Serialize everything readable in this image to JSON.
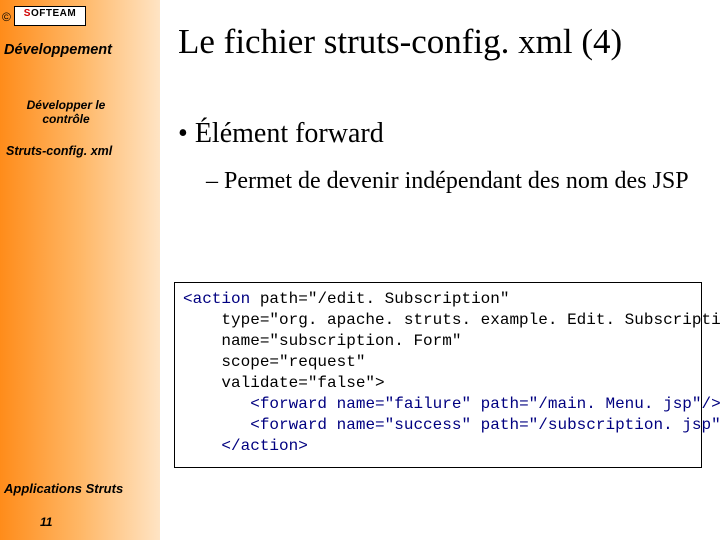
{
  "copyright_mark": "©",
  "logo": {
    "left": "S",
    "rest": "OFTEAM"
  },
  "sidebar": {
    "heading": "Développement",
    "sub1_l1": "Développer le",
    "sub1_l2": "contrôle",
    "sub2": "Struts-config. xml",
    "footer": "Applications Struts",
    "page": "11"
  },
  "title": "Le fichier struts-config. xml (4)",
  "bullet1": "Élément forward",
  "bullet2": "– Permet de devenir indépendant des nom des JSP",
  "code": {
    "action_open": "<action",
    "attr_path": "path=\"/edit. Subscription\"",
    "attr_type": "type=\"org. apache. struts. example. Edit. Subscription\"",
    "attr_name": "name=\"subscription. Form\"",
    "attr_scope": "scope=\"request\"",
    "attr_validate_close": "validate=\"false\">",
    "fwd1": "<forward name=\"failure\" path=\"/main. Menu. jsp\"/>",
    "fwd2": "<forward name=\"success\" path=\"/subscription. jsp\"/>",
    "action_close": "</action>"
  }
}
